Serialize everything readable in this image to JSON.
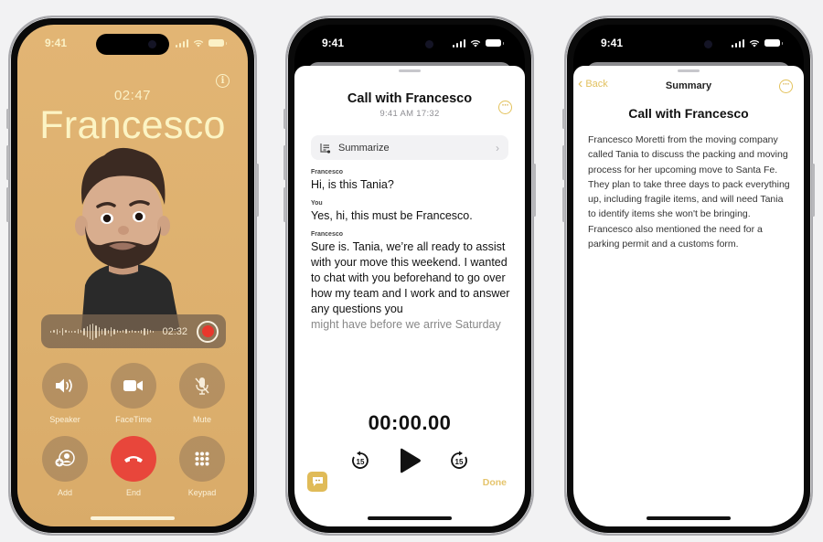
{
  "status_bar": {
    "time": "9:41"
  },
  "call_screen": {
    "elapsed": "02:47",
    "caller": "Francesco",
    "recording": {
      "elapsed": "02:32",
      "state": "recording"
    },
    "controls": [
      {
        "id": "speaker",
        "label": "Speaker",
        "icon": "speaker-icon"
      },
      {
        "id": "facetime",
        "label": "FaceTime",
        "icon": "video-camera-icon"
      },
      {
        "id": "mute",
        "label": "Mute",
        "icon": "mic-slash-icon"
      },
      {
        "id": "add",
        "label": "Add",
        "icon": "add-person-icon"
      },
      {
        "id": "end",
        "label": "End",
        "icon": "phone-hangup-icon"
      },
      {
        "id": "keypad",
        "label": "Keypad",
        "icon": "keypad-icon"
      }
    ],
    "colors": {
      "background": "#e0b372",
      "end_button": "#e8463b",
      "record_dot": "#e9372c"
    }
  },
  "transcript_screen": {
    "title": "Call with Francesco",
    "subtitle": "9:41 AM  17:32",
    "summarize_label": "Summarize",
    "entries": [
      {
        "speaker": "Francesco",
        "text": "Hi, is this Tania?"
      },
      {
        "speaker": "You",
        "text": "Yes, hi, this must be Francesco."
      },
      {
        "speaker": "Francesco",
        "text": "Sure is. Tania, we’re all ready to assist with your move this weekend. I wanted to chat with you beforehand to go over how my team and I work and to answer any questions you",
        "faded_tail": "might have before we arrive Saturday"
      }
    ],
    "player": {
      "time": "00:00.00",
      "skip_back": "15",
      "skip_forward": "15"
    },
    "done_label": "Done",
    "colors": {
      "accent": "#e0bb58"
    }
  },
  "summary_screen": {
    "back_label": "Back",
    "nav_title": "Summary",
    "title": "Call with Francesco",
    "body": "Francesco Moretti from the moving company called Tania to discuss the packing and moving process for her upcoming move to Santa Fe. They plan to take three days to pack everything up, including fragile items, and will need Tania to identify items she won't be bringing. Francesco also mentioned the need for a parking permit and a customs form."
  }
}
